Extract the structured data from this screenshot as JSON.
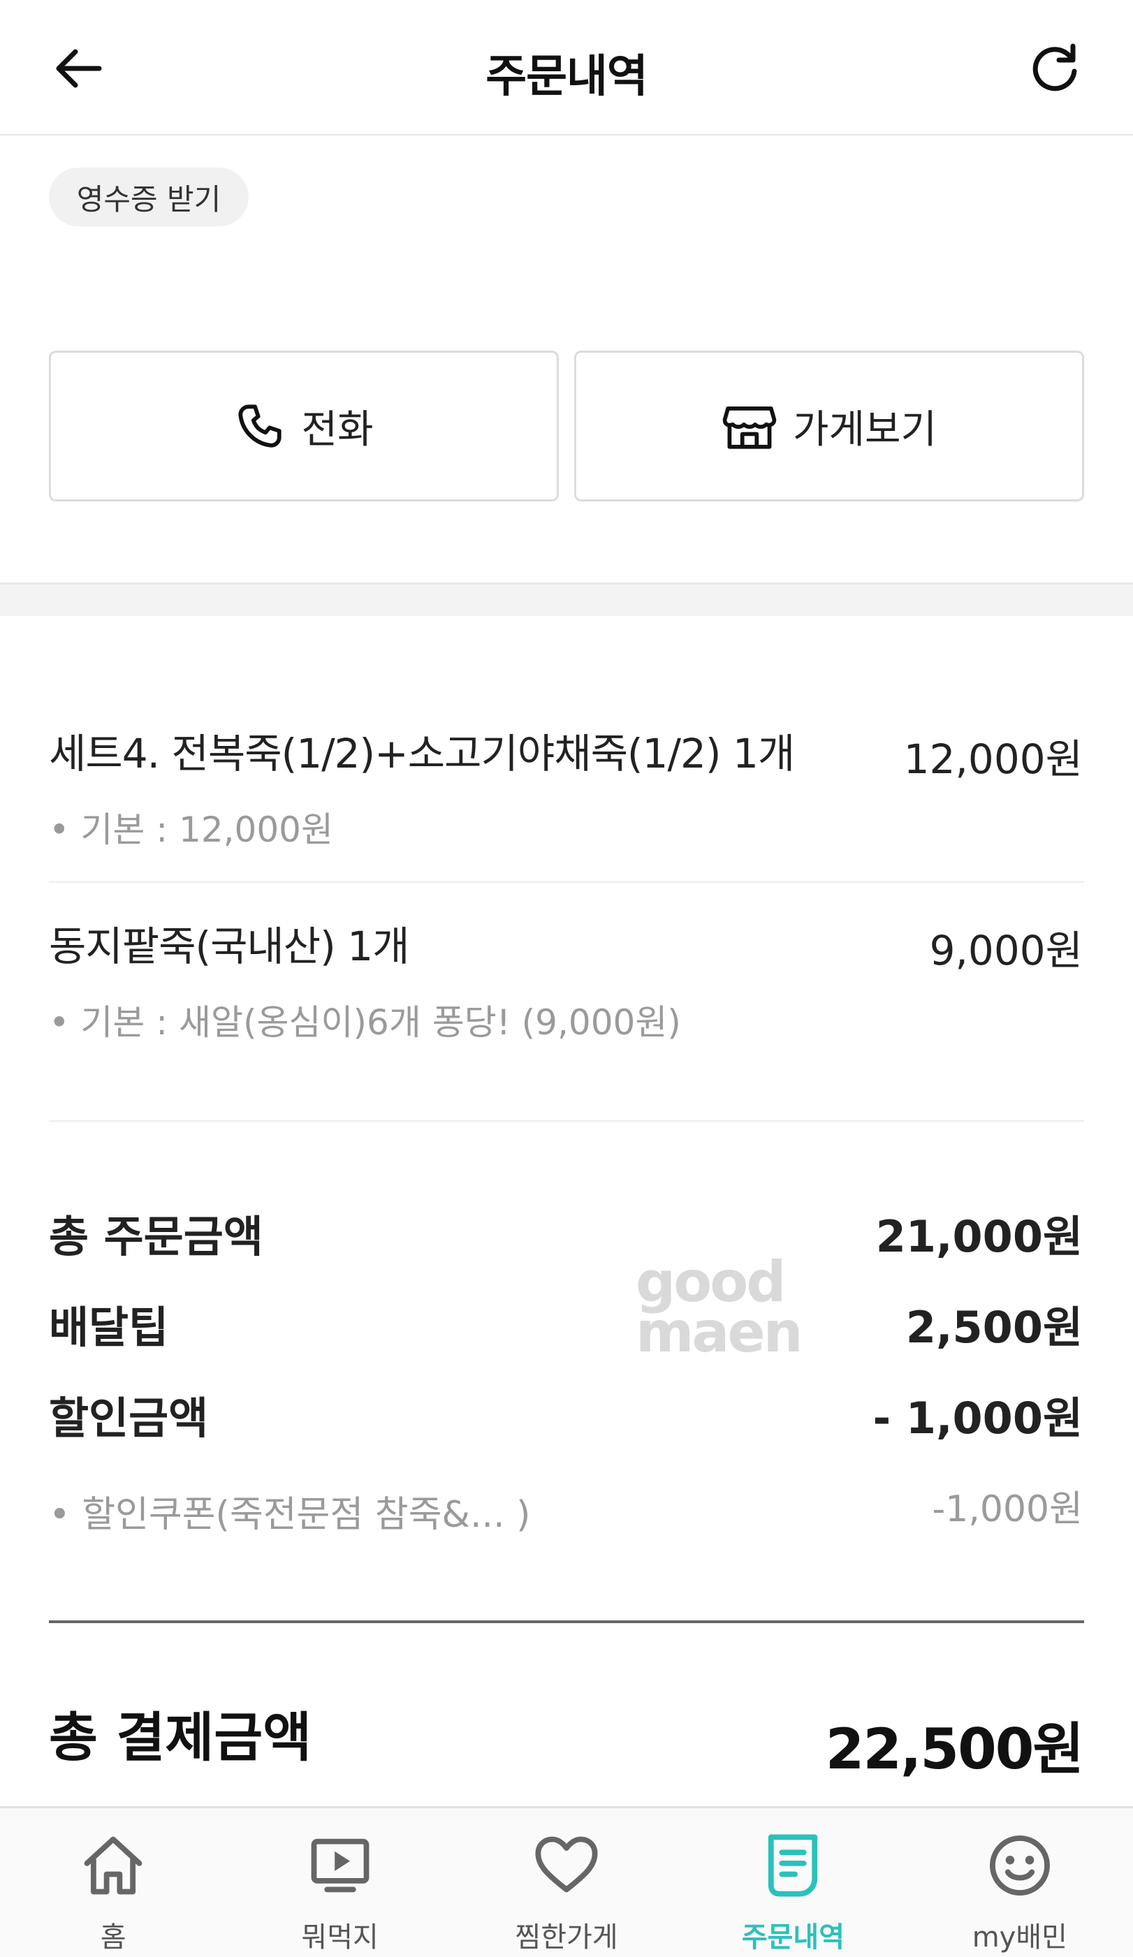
{
  "header": {
    "title": "주문내역",
    "back_icon": "arrow-left-icon",
    "refresh_icon": "refresh-icon"
  },
  "receipt": {
    "label": "영수증 받기"
  },
  "actions": {
    "call_label": "전화",
    "store_label": "가게보기"
  },
  "items": [
    {
      "name": "세트4. 전복죽(1/2)+소고기야채죽(1/2) 1개",
      "price": "12,000원",
      "option": "• 기본 : 12,000원"
    },
    {
      "name": "동지팥죽(국내산) 1개",
      "price": "9,000원",
      "option": "• 기본 : 새알(옹심이)6개 퐁당! (9,000원)"
    }
  ],
  "summary": {
    "order_total_label": "총 주문금액",
    "order_total_value": "21,000원",
    "delivery_tip_label": "배달팁",
    "delivery_tip_value": "2,500원",
    "discount_label": "할인금액",
    "discount_value": "- 1,000원",
    "coupon_label": "• 할인쿠폰(죽전문점 참죽&... )",
    "coupon_value": "-1,000원",
    "grand_total_label": "총 결제금액",
    "grand_total_value": "22,500원"
  },
  "watermark": {
    "line1": "good",
    "line2": "maen"
  },
  "nav": {
    "items": [
      {
        "label": "홈",
        "icon": "home-icon"
      },
      {
        "label": "뭐먹지",
        "icon": "play-screen-icon"
      },
      {
        "label": "찜한가게",
        "icon": "heart-icon"
      },
      {
        "label": "주문내역",
        "icon": "receipt-icon"
      },
      {
        "label": "my배민",
        "icon": "smiley-icon"
      }
    ],
    "active": "주문내역"
  },
  "colors": {
    "accent": "#2ac1bc",
    "muted_text": "#9a9a9a",
    "divider": "#ececec"
  }
}
